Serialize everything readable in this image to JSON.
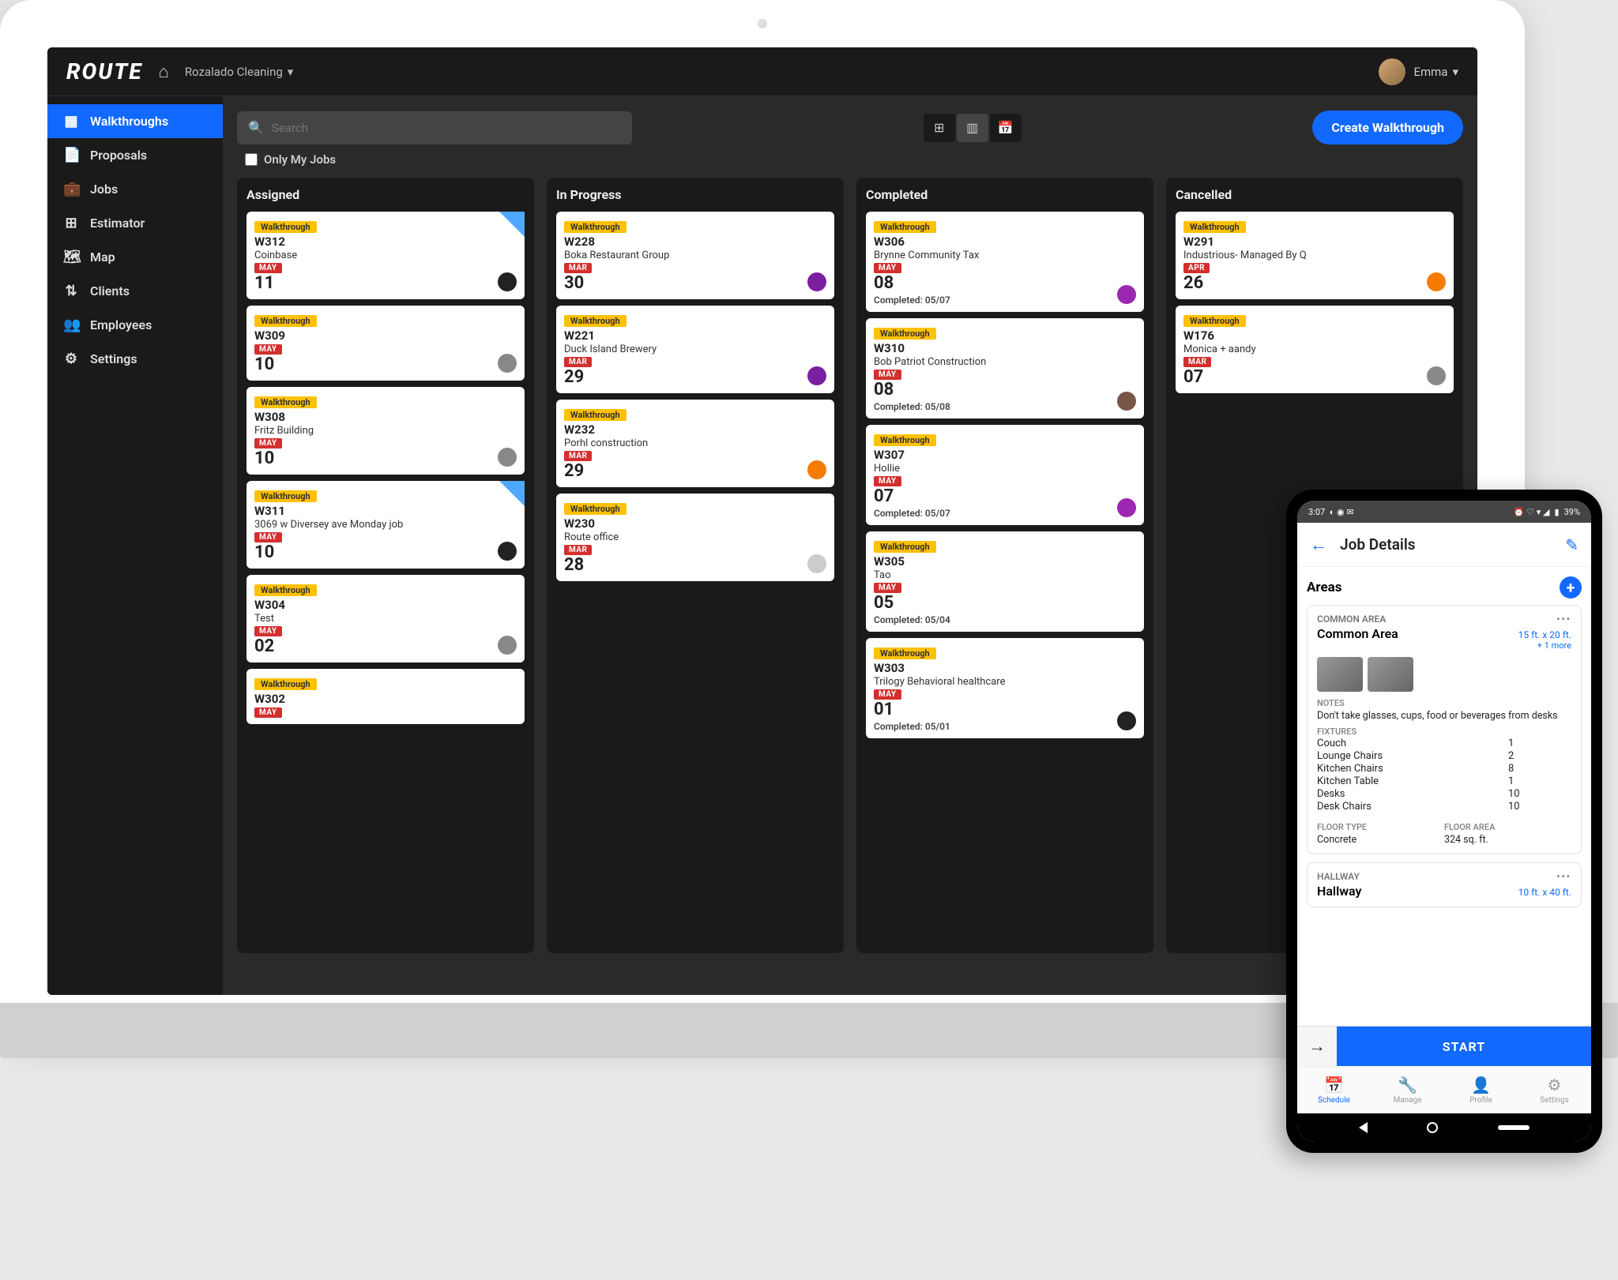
{
  "header": {
    "logo": "ROUTE",
    "org": "Rozalado Cleaning",
    "user": "Emma"
  },
  "sidebar": {
    "items": [
      {
        "icon": "▦",
        "label": "Walkthroughs",
        "active": true
      },
      {
        "icon": "📄",
        "label": "Proposals"
      },
      {
        "icon": "💼",
        "label": "Jobs"
      },
      {
        "icon": "⊞",
        "label": "Estimator"
      },
      {
        "icon": "🗺",
        "label": "Map"
      },
      {
        "icon": "⇅",
        "label": "Clients"
      },
      {
        "icon": "👥",
        "label": "Employees"
      },
      {
        "icon": "⚙",
        "label": "Settings"
      }
    ]
  },
  "toolbar": {
    "search_placeholder": "Search",
    "only_my_jobs": "Only My Jobs",
    "cta": "Create Walkthrough"
  },
  "columns": [
    {
      "title": "Assigned",
      "cards": [
        {
          "tag": "Walkthrough",
          "id": "W312",
          "client": "Coinbase",
          "month": "MAY",
          "day": "11",
          "ribbon": true,
          "av": "#222"
        },
        {
          "tag": "Walkthrough",
          "id": "W309",
          "client": "",
          "month": "MAY",
          "day": "10",
          "av": "#888"
        },
        {
          "tag": "Walkthrough",
          "id": "W308",
          "client": "Fritz Building",
          "month": "MAY",
          "day": "10",
          "av": "#888"
        },
        {
          "tag": "Walkthrough",
          "id": "W311",
          "client": "3069 w Diversey ave Monday job",
          "month": "MAY",
          "day": "10",
          "ribbon": true,
          "av": "#222"
        },
        {
          "tag": "Walkthrough",
          "id": "W304",
          "client": "Test",
          "month": "MAY",
          "day": "02",
          "av": "#888"
        },
        {
          "tag": "Walkthrough",
          "id": "W302",
          "client": "",
          "month": "MAY",
          "day": ""
        }
      ]
    },
    {
      "title": "In Progress",
      "cards": [
        {
          "tag": "Walkthrough",
          "id": "W228",
          "client": "Boka Restaurant Group",
          "month": "MAR",
          "day": "30",
          "av": "#7b1fa2"
        },
        {
          "tag": "Walkthrough",
          "id": "W221",
          "client": "Duck Island Brewery",
          "month": "MAR",
          "day": "29",
          "av": "#7b1fa2"
        },
        {
          "tag": "Walkthrough",
          "id": "W232",
          "client": "Porhl construction",
          "month": "MAR",
          "day": "29",
          "av": "#f57c00"
        },
        {
          "tag": "Walkthrough",
          "id": "W230",
          "client": "Route office",
          "month": "MAR",
          "day": "28",
          "av": "#ccc"
        }
      ]
    },
    {
      "title": "Completed",
      "cards": [
        {
          "tag": "Walkthrough",
          "id": "W306",
          "client": "Brynne Community Tax",
          "month": "MAY",
          "day": "08",
          "done": "Completed: 05/07",
          "av": "#9c27b0"
        },
        {
          "tag": "Walkthrough",
          "id": "W310",
          "client": "Bob Patriot Construction",
          "month": "MAY",
          "day": "08",
          "done": "Completed: 05/08",
          "av": "#795548"
        },
        {
          "tag": "Walkthrough",
          "id": "W307",
          "client": "Hollie",
          "month": "MAY",
          "day": "07",
          "done": "Completed: 05/07",
          "av": "#9c27b0"
        },
        {
          "tag": "Walkthrough",
          "id": "W305",
          "client": "Tao",
          "month": "MAY",
          "day": "05",
          "done": "Completed: 05/04"
        },
        {
          "tag": "Walkthrough",
          "id": "W303",
          "client": "Trilogy Behavioral healthcare",
          "month": "MAY",
          "day": "01",
          "done": "Completed: 05/01",
          "av": "#222"
        }
      ]
    },
    {
      "title": "Cancelled",
      "cards": [
        {
          "tag": "Walkthrough",
          "id": "W291",
          "client": "Industrious- Managed By Q",
          "month": "APR",
          "day": "26",
          "av": "#f57c00"
        },
        {
          "tag": "Walkthrough",
          "id": "W176",
          "client": "Monica + aandy",
          "month": "MAR",
          "day": "07",
          "av": "#888"
        }
      ]
    }
  ],
  "phone": {
    "status": {
      "time": "3:07",
      "battery": "39%"
    },
    "title": "Job Details",
    "areas_label": "Areas",
    "area1": {
      "type": "COMMON AREA",
      "name": "Common Area",
      "dim": "15 ft. x 20 ft.",
      "more": "+ 1 more",
      "notes_label": "NOTES",
      "notes": "Don't take glasses, cups, food or beverages from desks",
      "fixtures_label": "FIXTURES",
      "fixtures": [
        {
          "n": "Couch",
          "v": "1"
        },
        {
          "n": "Lounge Chairs",
          "v": "2"
        },
        {
          "n": "Kitchen Chairs",
          "v": "8"
        },
        {
          "n": "Kitchen Table",
          "v": "1"
        },
        {
          "n": "Desks",
          "v": "10"
        },
        {
          "n": "Desk Chairs",
          "v": "10"
        }
      ],
      "floor_type_label": "FLOOR TYPE",
      "floor_type": "Concrete",
      "floor_area_label": "FLOOR AREA",
      "floor_area": "324 sq. ft."
    },
    "area2": {
      "type": "HALLWAY",
      "name": "Hallway",
      "dim": "10 ft. x 40 ft."
    },
    "start": "START",
    "nav": [
      "Schedule",
      "Manage",
      "Profile",
      "Settings"
    ]
  }
}
